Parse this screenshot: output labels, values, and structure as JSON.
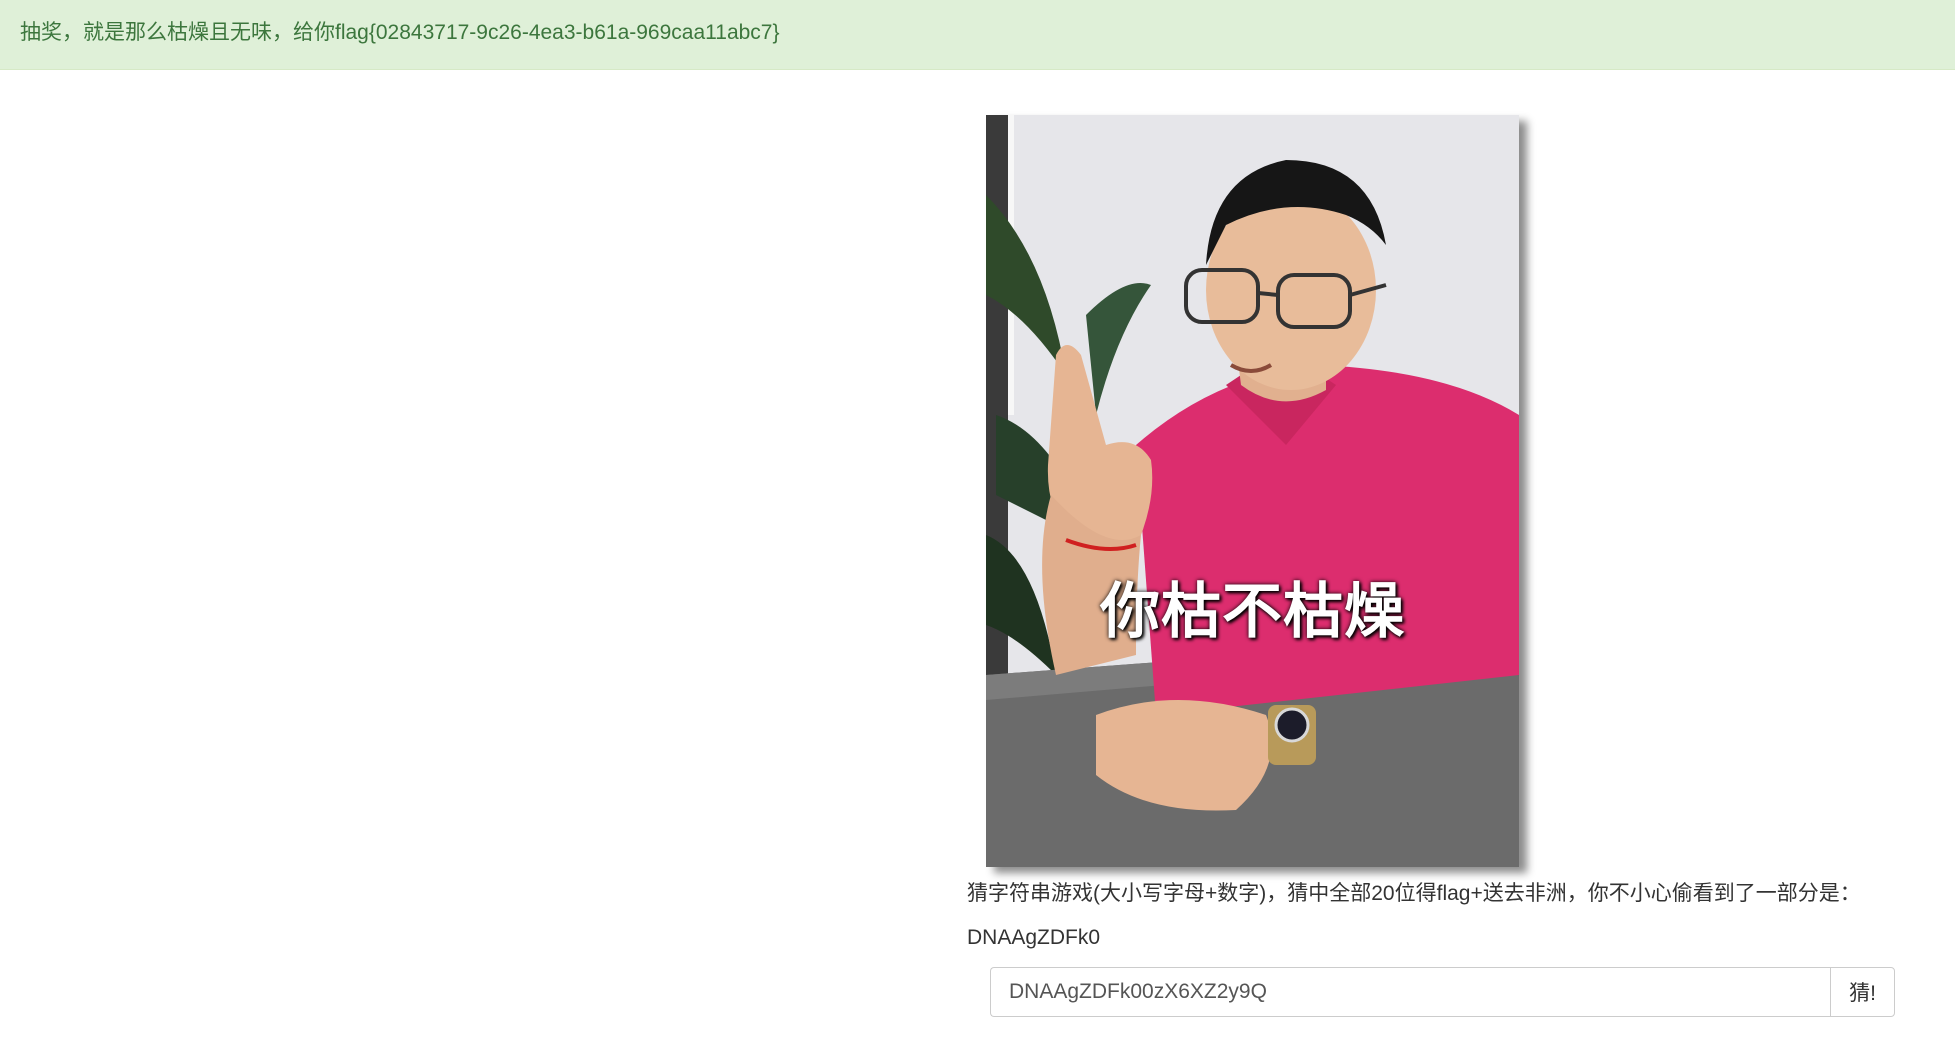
{
  "alert": {
    "message": "抽奖，就是那么枯燥且无味，给你flag{02843717-9c26-4ea3-b61a-969caa11abc7}"
  },
  "photo": {
    "caption": "你枯不枯燥"
  },
  "game": {
    "description": "猜字符串游戏(大小写字母+数字)，猜中全部20位得flag+送去非洲，你不小心偷看到了一部分是：",
    "partial": "DNAAgZDFk0",
    "input_value": "DNAAgZDFk00zX6XZ2y9Q",
    "button_label": "猜!"
  }
}
